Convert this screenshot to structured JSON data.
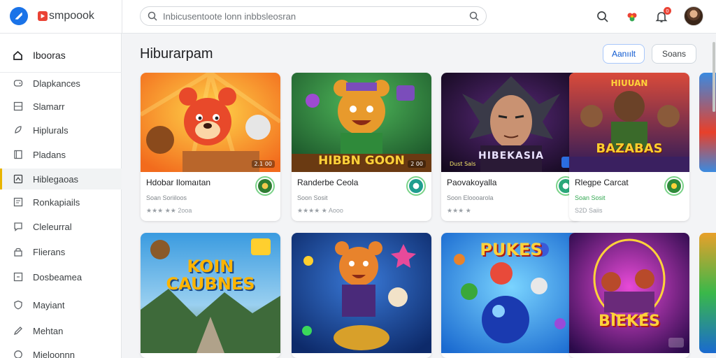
{
  "brand": {
    "name": "smpoook"
  },
  "search": {
    "placeholder": "Inbicusentoote lonn inbbsleosran"
  },
  "header": {
    "notification_count": "0"
  },
  "sidebar": {
    "items": [
      {
        "label": "Ibooras",
        "icon": "home-icon"
      },
      {
        "label": "Dlapkances",
        "icon": "gamepad-icon"
      },
      {
        "label": "Slamarr",
        "icon": "grid-icon"
      },
      {
        "label": "Hiplurals",
        "icon": "rocket-icon"
      },
      {
        "label": "Pladans",
        "icon": "book-icon"
      },
      {
        "label": "Hiblegaoas",
        "icon": "puzzle-icon"
      },
      {
        "label": "Ronkapiails",
        "icon": "trophy-icon"
      },
      {
        "label": "Cleleurral",
        "icon": "chat-icon"
      },
      {
        "label": "Flierans",
        "icon": "lock-icon"
      },
      {
        "label": "Dosbeamea",
        "icon": "box-icon"
      },
      {
        "label": "Mayiant",
        "icon": "shield-icon"
      },
      {
        "label": "Mehtan",
        "icon": "pen-icon"
      },
      {
        "label": "Mieloonnn",
        "icon": "globe-icon"
      }
    ]
  },
  "main": {
    "title": "Hiburarpam",
    "buttons": {
      "primary": "Aanıılt",
      "secondary": "Soans"
    },
    "row1": [
      {
        "name": "Hdobar Ilomaıtan",
        "sub": "Soan Soriiloos",
        "rating": "★★★ ★★ 2ooa",
        "art_text": "",
        "art_tag": "2.1 00"
      },
      {
        "name": "Randerbe Ceola",
        "sub": "Soon Sosit",
        "rating": "★★★★ ★ Aooo",
        "art_text": "HIBBN GOON",
        "art_tag": "2 00"
      },
      {
        "name": "Paovakoyalla",
        "sub": "Soon Eloooarola",
        "rating": "★★★ ★",
        "art_text": "HIBEKASIA",
        "art_tag": "Dust Sals"
      },
      {
        "name": "Rlegpe Carcat",
        "sub": "Soan Sosit",
        "rating": "S2D Saiis",
        "art_text": "BAZABAS",
        "art_tag": "HIUUAN"
      }
    ],
    "row2": [
      {
        "art_text": "KOIN CAUBNES"
      },
      {
        "art_text": ""
      },
      {
        "art_text": "PUKES"
      },
      {
        "art_text": "BIEKES"
      }
    ]
  },
  "colors": {
    "accent": "#1a73e8",
    "active_bar": "#e8b400",
    "badge_ring": "#7bd389"
  }
}
